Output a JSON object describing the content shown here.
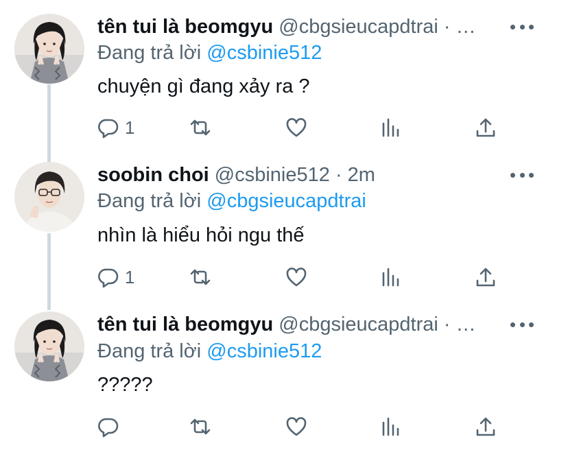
{
  "tweets": [
    {
      "name": "tên tui là beomgyu",
      "handle": "@cbgsieucapdtrai",
      "meta": "· …",
      "replying_prefix": "Đang trả lời",
      "replying_to": "@csbinie512",
      "text": "chuyện gì đang xảy ra ?",
      "reply_count": "1"
    },
    {
      "name": "soobin choi",
      "handle": "@csbinie512",
      "meta": "· 2m",
      "replying_prefix": "Đang trả lời",
      "replying_to": "@cbgsieucapdtrai",
      "text": "nhìn là hiểu hỏi ngu thế",
      "reply_count": "1"
    },
    {
      "name": "tên tui là beomgyu",
      "handle": "@cbgsieucapdtrai",
      "meta": "· …",
      "replying_prefix": "Đang trả lời",
      "replying_to": "@csbinie512",
      "text": "?????",
      "reply_count": ""
    }
  ],
  "colors": {
    "text": "#0f1419",
    "secondary": "#536471",
    "link": "#1d9bf0",
    "thread_line": "#cfd9de"
  },
  "icons": [
    "reply-icon",
    "retweet-icon",
    "like-icon",
    "views-icon",
    "share-icon",
    "more-icon"
  ]
}
